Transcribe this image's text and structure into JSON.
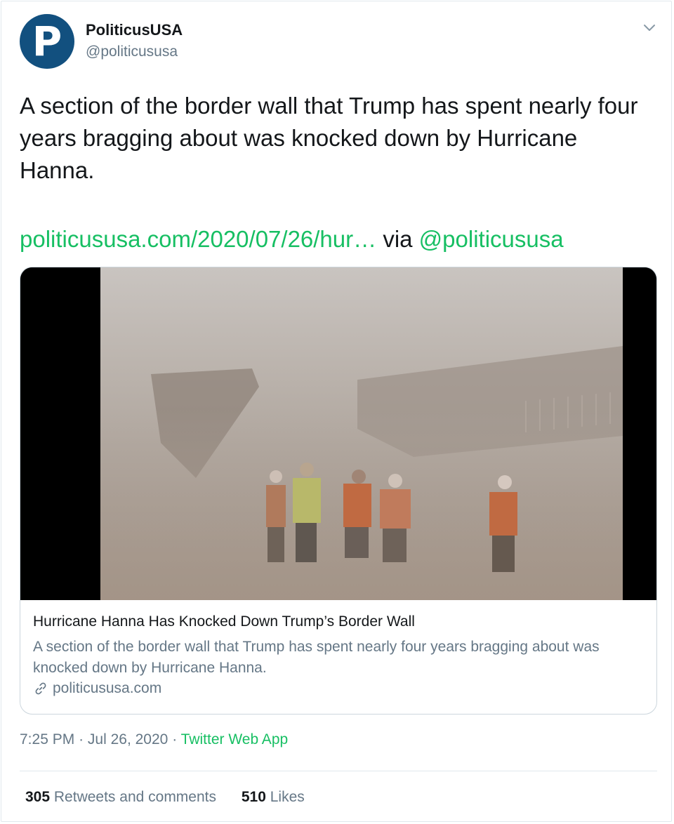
{
  "author": {
    "display_name": "PoliticusUSA",
    "handle": "@politicususa",
    "avatar_letter": "P",
    "avatar_color": "#12507f"
  },
  "tweet": {
    "text": "A section of the border wall that Trump has spent nearly four years bragging about was knocked down by Hurricane Hanna.",
    "link_text": "politicususa.com/2020/07/26/hur…",
    "via_text": "via",
    "via_handle": "@politicususa"
  },
  "card": {
    "title": "Hurricane Hanna Has Knocked Down Trump’s Border Wall",
    "description": "A section of the border wall that Trump has spent nearly four years bragging about was knocked down by Hurricane Hanna.",
    "domain": "politicususa.com",
    "image_icon": "video-thumbnail"
  },
  "meta": {
    "time": "7:25 PM",
    "separator": "·",
    "date": "Jul 26, 2020",
    "source": "Twitter Web App"
  },
  "stats": {
    "retweets_count": "305",
    "retweets_label": "Retweets and comments",
    "likes_count": "510",
    "likes_label": "Likes"
  },
  "colors": {
    "link": "#17bf63",
    "secondary": "#657786",
    "text": "#14171a"
  }
}
